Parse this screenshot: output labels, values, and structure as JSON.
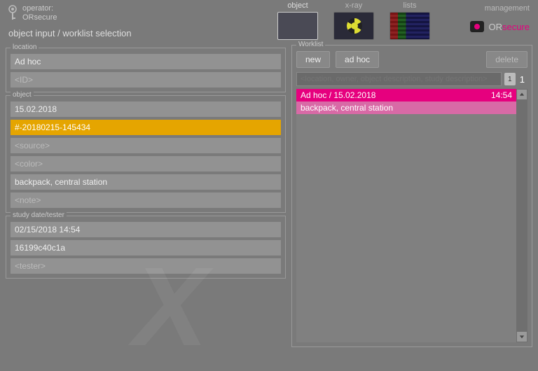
{
  "header": {
    "operator_label": "operator:",
    "operator_value": "ORsecure",
    "subtitle": "object input / worklist selection"
  },
  "nav": {
    "items": [
      {
        "label": "object",
        "active": true
      },
      {
        "label": "x-ray",
        "active": false
      },
      {
        "label": "lists",
        "active": false
      }
    ],
    "management_label": "management",
    "brand_or": "OR",
    "brand_secure": "secure"
  },
  "location": {
    "panel_label": "location",
    "value": "Ad hoc",
    "id_placeholder": "<ID>"
  },
  "object": {
    "panel_label": "object",
    "date": "15.02.2018",
    "ref": "#-20180215-145434",
    "source_placeholder": "<source>",
    "color_placeholder": "<color>",
    "description": "backpack, central station",
    "note_placeholder": "<note>"
  },
  "study": {
    "panel_label": "study date/tester",
    "datetime": "02/15/2018 14:54",
    "code": "16199c40c1a",
    "tester_placeholder": "<tester>"
  },
  "worklist": {
    "panel_label": "Worklist",
    "new_btn": "new",
    "adhoc_btn": "ad hoc",
    "delete_btn": "delete",
    "filter_placeholder": "<location, owner, object description, study description>",
    "filter_badge": "1",
    "count": "1",
    "rows": [
      {
        "title": "Ad hoc  /  15.02.2018",
        "time": "14:54",
        "subtitle": "backpack, central station"
      }
    ]
  }
}
